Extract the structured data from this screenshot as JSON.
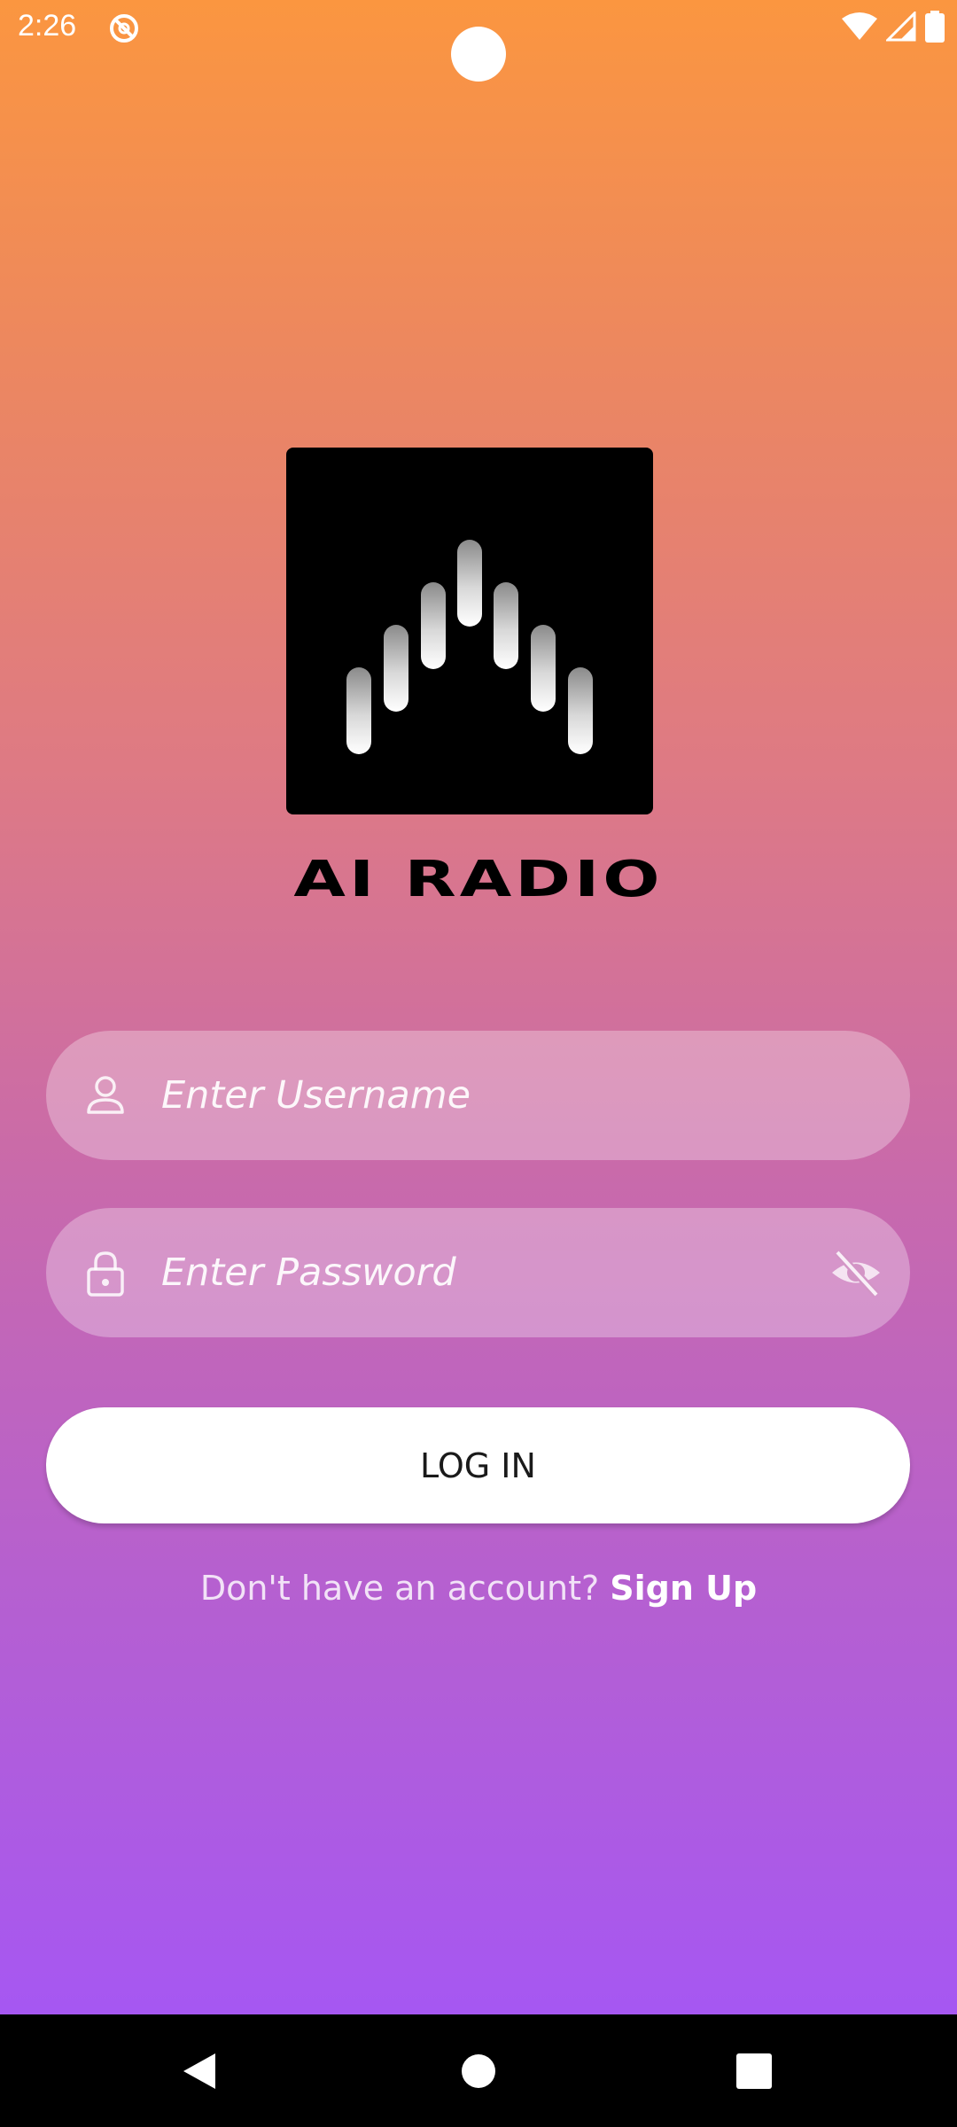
{
  "status_bar": {
    "time": "2:26",
    "icons": [
      "do-not-disturb-icon",
      "wifi-icon",
      "cellular-signal-icon",
      "battery-icon"
    ]
  },
  "logo": {
    "title": "AI RADIO",
    "icon": "equalizer-bars-icon"
  },
  "form": {
    "username": {
      "placeholder": "Enter Username",
      "value": "",
      "icon": "person-icon"
    },
    "password": {
      "placeholder": "Enter Password",
      "value": "",
      "icon": "lock-icon",
      "toggle_icon": "eye-off-icon"
    },
    "login_label": "LOG IN",
    "signup_prompt": "Don't have an account?",
    "signup_link": "Sign Up"
  },
  "nav_bar": {
    "icons": [
      "back-icon",
      "home-icon",
      "recents-icon"
    ]
  },
  "colors": {
    "gradient_top": "#fb9640",
    "gradient_bottom": "#a657f2",
    "logo_bg": "#000000",
    "button_bg": "#ffffff"
  }
}
